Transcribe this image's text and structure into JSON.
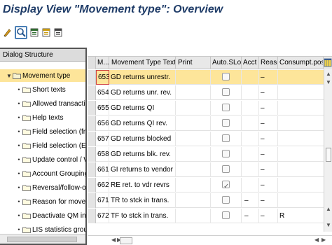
{
  "title": "Display View \"Movement type\": Overview",
  "toolbar": {
    "icons": [
      "pencil-glasses-icon",
      "details-icon",
      "select-all-icon",
      "select-block-icon",
      "deselect-all-icon"
    ]
  },
  "dialog_structure": {
    "header": "Dialog Structure",
    "root": "Movement type",
    "items": [
      "Short texts",
      "Allowed transaction",
      "Help texts",
      "Field selection (from",
      "Field selection (Enjo",
      "Update control / W",
      "Account Grouping",
      "Reversal/follow-on r",
      "Reason for moveme",
      "Deactivate QM insp",
      "LIS statistics group"
    ]
  },
  "table": {
    "columns": [
      "M...",
      "Movement Type Text",
      "Print",
      "Auto.SLoc.",
      "Acct",
      "Reas.",
      "Consumpt.postg"
    ],
    "rows": [
      {
        "mvt": "653",
        "text": "GD returns unrestr.",
        "print": "",
        "auto": false,
        "acct": "",
        "reas": "–",
        "cons": ""
      },
      {
        "mvt": "654",
        "text": "GD returns unr. rev.",
        "print": "",
        "auto": false,
        "acct": "",
        "reas": "–",
        "cons": ""
      },
      {
        "mvt": "655",
        "text": "GD returns QI",
        "print": "",
        "auto": false,
        "acct": "",
        "reas": "–",
        "cons": ""
      },
      {
        "mvt": "656",
        "text": "GD returns QI  rev.",
        "print": "",
        "auto": false,
        "acct": "",
        "reas": "–",
        "cons": ""
      },
      {
        "mvt": "657",
        "text": "GD returns blocked",
        "print": "",
        "auto": false,
        "acct": "",
        "reas": "–",
        "cons": ""
      },
      {
        "mvt": "658",
        "text": "GD returns blk. rev.",
        "print": "",
        "auto": false,
        "acct": "",
        "reas": "–",
        "cons": ""
      },
      {
        "mvt": "661",
        "text": "GI returns to vendor",
        "print": "",
        "auto": false,
        "acct": "",
        "reas": "–",
        "cons": ""
      },
      {
        "mvt": "662",
        "text": "RE ret. to vdr revrs",
        "print": "",
        "auto": true,
        "acct": "",
        "reas": "–",
        "cons": ""
      },
      {
        "mvt": "671",
        "text": "TR to stck in trans.",
        "print": "",
        "auto": false,
        "acct": "–",
        "reas": "–",
        "cons": ""
      },
      {
        "mvt": "672",
        "text": "TF to stck in trans.",
        "print": "",
        "auto": false,
        "acct": "–",
        "reas": "–",
        "cons": "R"
      }
    ]
  },
  "colors": {
    "title": "#1f3c68",
    "highlight": "#fde59a",
    "header_bg": "#e8e8e8"
  }
}
